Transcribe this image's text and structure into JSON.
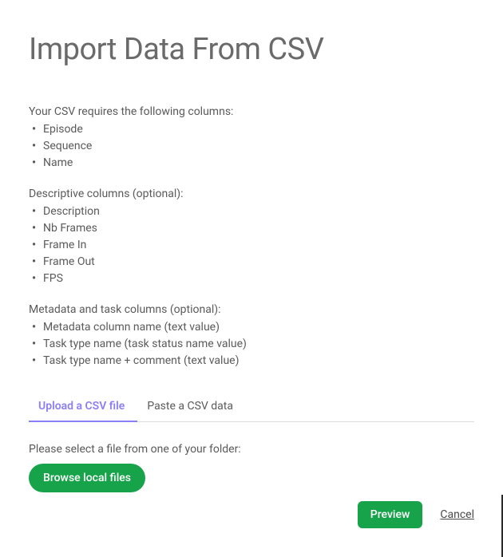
{
  "title": "Import Data From CSV",
  "required": {
    "lead": "Your CSV requires the following columns:",
    "items": [
      "Episode",
      "Sequence",
      "Name"
    ]
  },
  "descriptive": {
    "lead": "Descriptive columns (optional):",
    "items": [
      "Description",
      "Nb Frames",
      "Frame In",
      "Frame Out",
      "FPS"
    ]
  },
  "metadata": {
    "lead": "Metadata and task columns (optional):",
    "items": [
      "Metadata column name (text value)",
      "Task type name (task status name value)",
      "Task type name + comment (text value)"
    ]
  },
  "tabs": {
    "upload": "Upload a CSV file",
    "paste": "Paste a CSV data"
  },
  "filePrompt": "Please select a file from one of your folder:",
  "buttons": {
    "browse": "Browse local files",
    "preview": "Preview",
    "cancel": "Cancel"
  }
}
